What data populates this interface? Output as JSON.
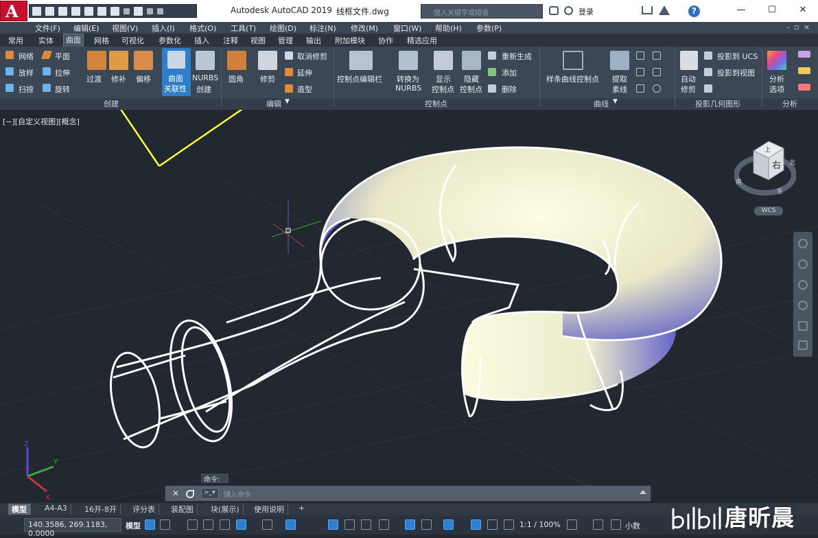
{
  "window": {
    "app_title": "Autodesk AutoCAD 2019",
    "file_name": "线框文件.dwg",
    "search_placeholder": "键入关键字或短语",
    "login_label": "登录",
    "help_label": "?",
    "controls": [
      "—",
      "☐",
      "✕"
    ]
  },
  "menu": [
    "文件(F)",
    "编辑(E)",
    "视图(V)",
    "插入(I)",
    "格式(O)",
    "工具(T)",
    "绘图(D)",
    "标注(N)",
    "修改(M)",
    "窗口(W)",
    "帮助(H)",
    "参数(P)"
  ],
  "ribbon_tabs": [
    "常用",
    "实体",
    "曲面",
    "网格",
    "可视化",
    "参数化",
    "插入",
    "注释",
    "视图",
    "管理",
    "输出",
    "附加模块",
    "协作",
    "精选应用"
  ],
  "active_tab": "曲面",
  "ribbon": {
    "create": {
      "title": "创建",
      "small": [
        "网络",
        "平面",
        "放样",
        "拉伸",
        "扫掠",
        "旋转"
      ],
      "large": [
        "过渡",
        "修补",
        "偏移"
      ],
      "assoc_line1": "曲面",
      "assoc_line2": "关联性",
      "nurbs_line1": "NURBS",
      "nurbs_line2": "创建"
    },
    "edit": {
      "title": "编辑",
      "large": [
        "圆角",
        "修剪"
      ],
      "small": [
        "取消修剪",
        "延伸",
        "造型"
      ]
    },
    "control_points": {
      "title": "控制点",
      "bar": "控制点编辑栏",
      "convert_line1": "转换为",
      "convert_line2": "NURBS",
      "show_line1": "显示",
      "show_line2": "控制点",
      "hide_line1": "隐藏",
      "hide_line2": "控制点",
      "small": [
        "重新生成",
        "添加",
        "删除"
      ]
    },
    "curves": {
      "title": "曲线",
      "spline": "样条曲线控制点",
      "extract_line1": "提取",
      "extract_line2": "素线"
    },
    "projection": {
      "title": "投影几何图形",
      "auto_line1": "自动",
      "auto_line2": "修剪",
      "small": [
        "投影到 UCS",
        "投影到视图"
      ]
    },
    "analysis": {
      "title": "分析",
      "options_line1": "分析",
      "options_line2": "选项"
    }
  },
  "viewport": {
    "label": "[−][自定义视图][概念]",
    "navcube_face": "右",
    "navcube_top": "上",
    "compass": [
      "南",
      "东",
      "北"
    ],
    "wcs": "WCS",
    "ucs_axes": [
      "X",
      "Y",
      "Z"
    ]
  },
  "command": {
    "history_label": "命令:",
    "placeholder": "键入命令"
  },
  "layout_tabs": [
    "模型",
    "A4-A3",
    "16开-8开",
    "评分表",
    "装配图",
    "块(展示)",
    "使用说明",
    "+"
  ],
  "active_layout": "模型",
  "status": {
    "coords": "140.3586, 269.1183, 0.0000",
    "model": "模型",
    "scale": "1:1 / 100%",
    "units": "小数"
  },
  "watermark": "唐昕晨",
  "colors": {
    "accent_red": "#c8102e",
    "ribbon_bg": "#3b4755",
    "viewport_bg": "#212830",
    "annotation_arrow": "#ffff33",
    "status_active": "#2c7fd1"
  }
}
